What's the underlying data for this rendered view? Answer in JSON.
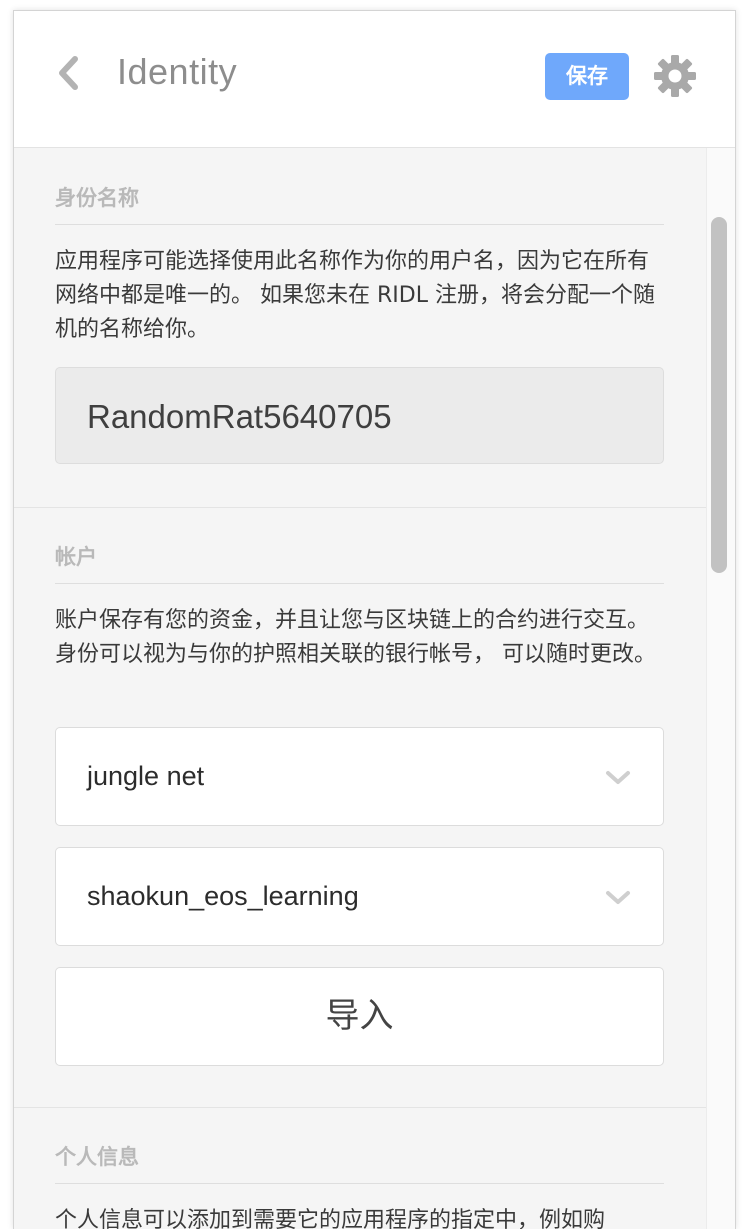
{
  "header": {
    "title": "Identity",
    "save_label": "保存",
    "accent_color": "#6fa8fb"
  },
  "identity_name": {
    "title": "身份名称",
    "description": "应用程序可能选择使用此名称作为你的用户名，因为它在所有网络中都是唯一的。 如果您未在 RIDL 注册，将会分配一个随机的名称给你。",
    "value": "RandomRat5640705"
  },
  "accounts": {
    "title": "帐户",
    "description": "账户保存有您的资金，并且让您与区块链上的合约进行交互。 身份可以视为与你的护照相关联的银行帐号， 可以随时更改。",
    "network_select": "jungle net",
    "account_select": "shaokun_eos_learning",
    "import_label": "导入"
  },
  "personal_info": {
    "title": "个人信息",
    "description": "个人信息可以添加到需要它的应用程序的指定中，例如购"
  },
  "icons": {
    "back": "chevron-left-icon",
    "settings": "gear-icon",
    "dropdown": "chevron-down-icon"
  }
}
